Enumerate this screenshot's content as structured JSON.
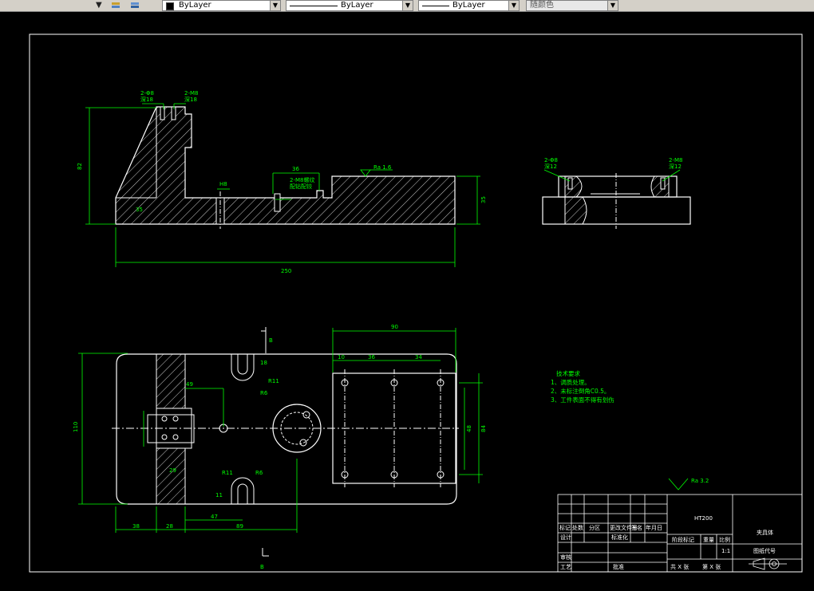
{
  "toolbar": {
    "layer_combo": {
      "value": "ByLayer"
    },
    "linetype_combo": {
      "value": "ByLayer"
    },
    "lineweight_combo": {
      "value": "ByLayer"
    },
    "color_combo": {
      "value": "随颜色"
    },
    "icons": [
      "layer-states-icon",
      "layer-previous-icon",
      "dropdown-arrow-icon"
    ]
  },
  "drawing": {
    "dims": {
      "top_width": "36",
      "height_left": "82",
      "height_right": "35",
      "base_height": "35",
      "h8": "H8",
      "total_length": "250",
      "plan_width": "90",
      "plan_sub1": "10",
      "plan_sub2": "36",
      "plan_sub3": "34",
      "plan_height": "110",
      "dim_49": "49",
      "dim_47": "47",
      "dim_89": "89",
      "dim_38": "38",
      "dim_28": "28",
      "dim_29": "29",
      "dim_11": "11",
      "dim_18": "18",
      "r11a": "R11",
      "r11b": "R11",
      "r6a": "R6",
      "r6b": "R6",
      "vert_48": "48",
      "vert_84": "84",
      "hole_note_a": "2-Φ8",
      "hole_note_b": "2-M8",
      "hole_depth_a": "深18",
      "hole_depth_b": "深18",
      "hole_note_c": "2-Φ8",
      "hole_note_d": "2-M8",
      "hole_depth_c": "深12",
      "hole_depth_d": "深12",
      "center_note": "2-M8螺纹",
      "center_note2": "配钻配铰",
      "rough1": "Ra 1.6",
      "section_b_top": "B",
      "section_b_bottom": "B"
    },
    "tech_req": {
      "title": "技术要求",
      "items": [
        "1、调质处理。",
        "2、未标注倒角C0.5。",
        "3、工件表面不得有划伤"
      ]
    },
    "roughness_general": "Ra 3.2",
    "title_block": {
      "material": "HT200",
      "part_name": "夹具体",
      "drawing_code_label": "图纸代号",
      "scale": "1:1",
      "sheet_total": "共 X 张",
      "sheet_no": "第 X 张",
      "headers": [
        "标记",
        "处数",
        "分区",
        "更改文件号",
        "签名",
        "年月日"
      ],
      "design": "设计",
      "standardize": "标准化",
      "stage_mark": "阶段标记",
      "weight": "重量",
      "ratio": "比例",
      "review": "审核",
      "process": "工艺",
      "approve": "批准"
    }
  }
}
